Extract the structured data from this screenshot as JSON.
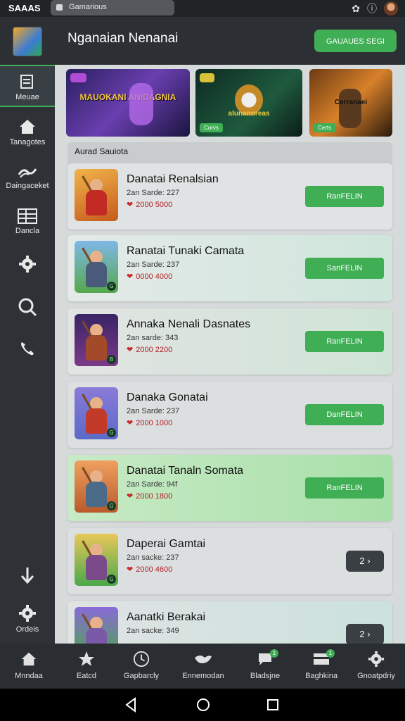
{
  "status": {
    "app": "SAAAS",
    "tab_title": "Gamarious"
  },
  "header": {
    "title": "Nganaian Nenanai",
    "action_label": "GAUAUES SEGI"
  },
  "sidebar": {
    "items": [
      {
        "label": "Meuae",
        "icon": "document-icon"
      },
      {
        "label": "Tanagotes",
        "icon": "home-icon"
      },
      {
        "label": "Daingaceket",
        "icon": "waves-icon"
      },
      {
        "label": "Dancla",
        "icon": "grid-icon"
      },
      {
        "label": "",
        "icon": "gear-icon"
      },
      {
        "label": "",
        "icon": "search-icon"
      },
      {
        "label": "",
        "icon": "phone-icon"
      },
      {
        "label": "",
        "icon": "arrow-down-icon"
      },
      {
        "label": "Ordeis",
        "icon": "gear-icon"
      }
    ]
  },
  "banners": [
    {
      "tag": "",
      "title": "MAUOKANI ANIDAGNIA",
      "badge": ""
    },
    {
      "tag": "",
      "title": "alunanoreas",
      "badge": "Corvs"
    },
    {
      "tag": "",
      "title": "Cerranaei",
      "badge": "Certs"
    }
  ],
  "section": {
    "title": "Aurad Sauiota"
  },
  "games": [
    {
      "name": "Danatai Renalsian",
      "sub": "2an Sarde: 227",
      "price": "2000 5000",
      "action": "RanFELIN",
      "action_type": "button"
    },
    {
      "name": "Ranatai Tunaki Camata",
      "sub": "2an Sarde: 237",
      "price": "0000 4000",
      "action": "SanFELIN",
      "action_type": "button"
    },
    {
      "name": "Annaka Nenali Dasnates",
      "sub": "2an sarde: 343",
      "price": "2000 2200",
      "action": "RanFELIN",
      "action_type": "button"
    },
    {
      "name": "Danaka Gonatai",
      "sub": "2an Sarde: 237",
      "price": "2000 1000",
      "action": "DanFELIN",
      "action_type": "button"
    },
    {
      "name": "Danatai Tanaln Somata",
      "sub": "2an Sarde: 94f",
      "price": "2000 1800",
      "action": "RanFELIN",
      "action_type": "button"
    },
    {
      "name": "Daperai Gamtai",
      "sub": "2an sacke: 237",
      "price": "2000 4600",
      "action": "2",
      "action_type": "pill"
    },
    {
      "name": "Aanatki Berakai",
      "sub": "2an sacke: 349",
      "price": "",
      "action": "2",
      "action_type": "pill"
    }
  ],
  "bottom_tabs": [
    {
      "label": "Mnndaa",
      "icon": "home-icon"
    },
    {
      "label": "Eatcd",
      "icon": "star-icon"
    },
    {
      "label": "Gapbarcly",
      "icon": "clock-icon"
    },
    {
      "label": "Ennemodan",
      "icon": "bird-icon"
    },
    {
      "label": "Bladsjne",
      "icon": "chat-icon",
      "notification": "1"
    },
    {
      "label": "Baghkina",
      "icon": "card-icon",
      "notification": "1"
    },
    {
      "label": "Gnoatpdriy",
      "icon": "gear-icon"
    }
  ],
  "colors": {
    "accent_green": "#3fae55",
    "dark_bg": "#2c3034",
    "main_bg": "#d7dadb"
  }
}
